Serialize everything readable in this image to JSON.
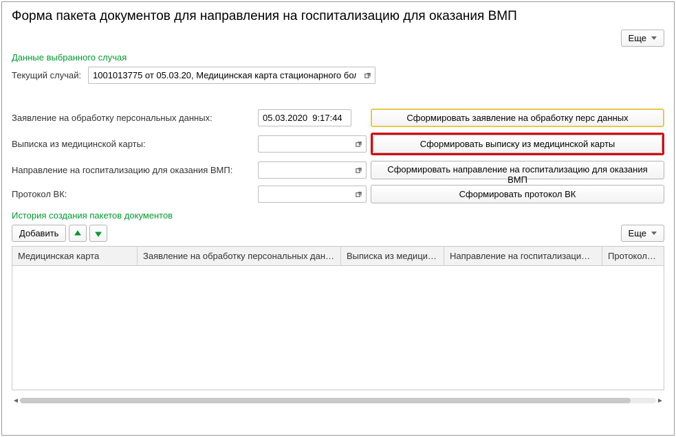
{
  "title": "Форма пакета документов для направления на госпитализацию для оказания ВМП",
  "more_label": "Еще",
  "case_section": {
    "title": "Данные выбранного случая",
    "label": "Текущий случай:",
    "value": "1001013775 от 05.03.20, Медицинская карта стационарного бол"
  },
  "docs": {
    "row1": {
      "label": "Заявление на обработку персональных данных:",
      "value": "05.03.2020  9:17:44",
      "btn": "Сформировать заявление на обработку перс данных"
    },
    "row2": {
      "label": "Выписка из медицинской карты:",
      "value": "",
      "btn": "Сформировать выписку из медицинской карты"
    },
    "row3": {
      "label": "Направление на госпитализацию для оказания ВМП:",
      "value": "",
      "btn": "Сформировать направление на госпитализацию для оказания ВМП"
    },
    "row4": {
      "label": "Протокол ВК:",
      "value": "",
      "btn": "Сформировать протокол ВК"
    }
  },
  "history": {
    "title": "История создания пакетов документов",
    "add_btn": "Добавить",
    "cols": {
      "c1": "Медицинская карта",
      "c2": "Заявление на обработку персональных данных",
      "c3": "Выписка из медицин...",
      "c4": "Направление на госпитализацию дл...",
      "c5": "Протокол ВК"
    }
  }
}
